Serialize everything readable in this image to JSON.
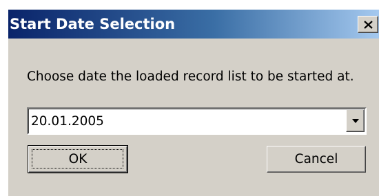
{
  "window": {
    "title": "Start Date Selection",
    "close_icon": "close-icon"
  },
  "dialog": {
    "message": "Choose date the loaded record list to be started at.",
    "date_combo": {
      "value": "20.01.2005",
      "arrow_icon": "chevron-down-icon"
    },
    "ok_label": "OK",
    "cancel_label": "Cancel"
  },
  "colors": {
    "face": "#d4d0c8",
    "title_start": "#0a246a",
    "title_end": "#a6caf0"
  }
}
